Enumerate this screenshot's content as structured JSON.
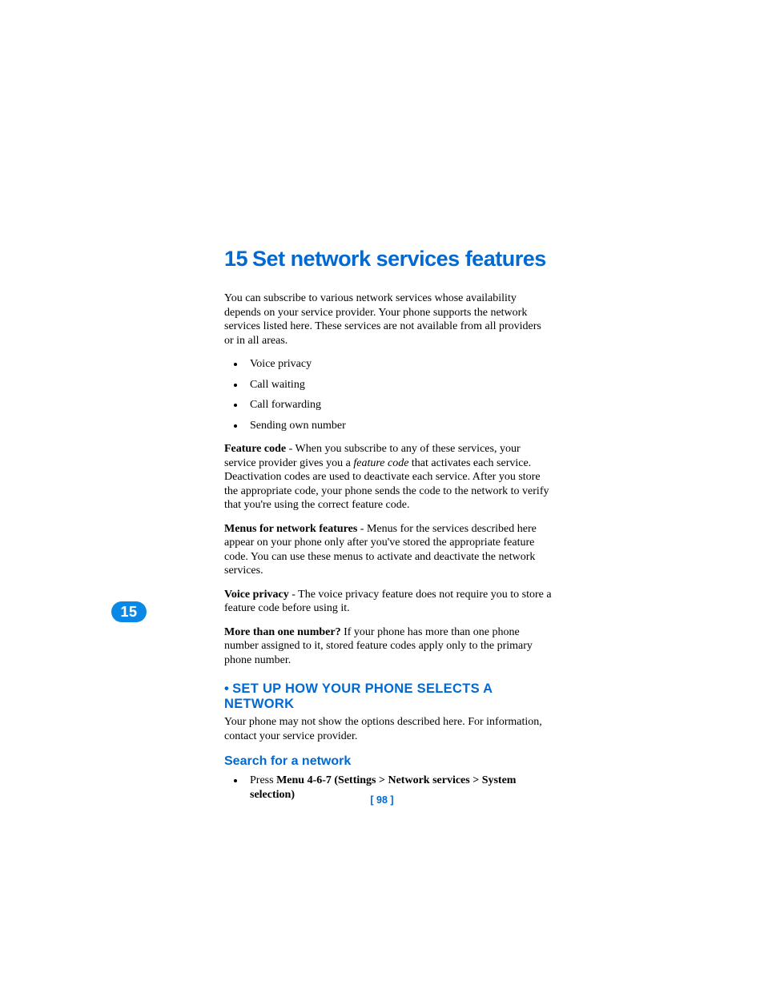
{
  "chapter": {
    "number": "15",
    "title": "Set network services features"
  },
  "intro": "You can subscribe to various network services whose availability depends on your service provider. Your phone supports the network services listed here. These services are not available from all providers or in all areas.",
  "services": [
    "Voice privacy",
    "Call waiting",
    "Call forwarding",
    "Sending own number"
  ],
  "paragraphs": {
    "feature_code": {
      "label": "Feature code",
      "text_before_italic": " - When you subscribe to any of these services, your service provider gives you a ",
      "italic": "feature code",
      "text_after_italic": " that activates each service. Deactivation codes are used to deactivate each service. After you store the appropriate code, your phone sends the code to the network to verify that you're using the correct feature code."
    },
    "menus": {
      "label": "Menus for network features",
      "text": " - Menus for the services described here appear on your phone only after you've stored the appropriate feature code. You can use these menus to activate and deactivate the network services."
    },
    "voice_privacy": {
      "label": "Voice privacy",
      "text": " - The voice privacy feature does not require you to store a feature code before using it."
    },
    "more_than_one": {
      "label": "More than one number?",
      "text": " If your phone has more than one phone number assigned to it, stored feature codes apply only to the primary phone number."
    }
  },
  "section": {
    "heading": "SET UP HOW YOUR PHONE SELECTS A NETWORK",
    "intro": "Your phone may not show the options described here. For information, contact your service provider."
  },
  "subsection": {
    "heading": "Search for a network",
    "step_prefix": "Press ",
    "step_bold": "Menu 4-6-7 (Settings > Network services > System selection)"
  },
  "side_tab": "15",
  "page_label": "[ 98 ]"
}
